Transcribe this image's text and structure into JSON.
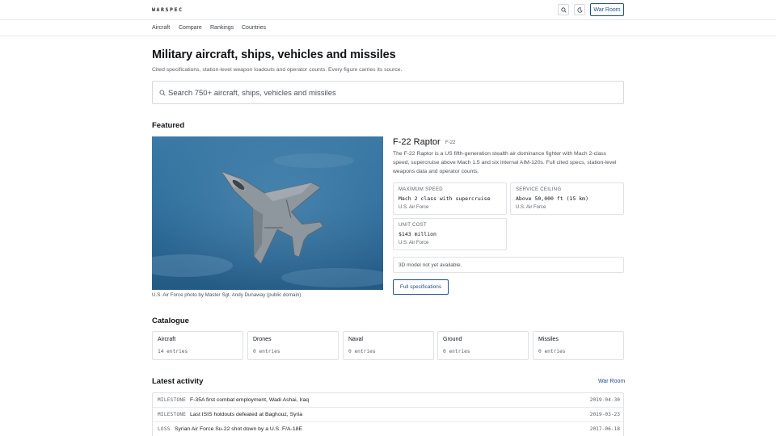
{
  "brand": {
    "logo": "WARSPEC"
  },
  "header": {
    "war_room_label": "War Room"
  },
  "nav": {
    "items": [
      "Aircraft",
      "Compare",
      "Rankings",
      "Countries"
    ]
  },
  "hero": {
    "title": "Military aircraft, ships, vehicles and missiles",
    "subtitle": "Cited specifications, station-level weapon loadouts and operator counts. Every figure carries its source."
  },
  "search": {
    "placeholder": "Search 750+ aircraft, ships, vehicles and missiles"
  },
  "featured": {
    "section_title": "Featured",
    "name": "F-22 Raptor",
    "code": "F-22",
    "description": "The F-22 Raptor is a US fifth-generation stealth air dominance fighter with Mach 2-class speed, supercruise above Mach 1.5 and six internal AIM-120s. Full cited specs, station-level weapons data and operator counts.",
    "image_credit": "U.S. Air Force photo by Master Sgt. Andy Dunaway (public domain)",
    "specs": [
      {
        "label": "MAXIMUM SPEED",
        "value": "Mach 2 class with supercruise",
        "source": "U.S. Air Force"
      },
      {
        "label": "SERVICE CEILING",
        "value": "Above 50,000 ft (15 km)",
        "source": "U.S. Air Force"
      },
      {
        "label": "UNIT COST",
        "value": "$143 million",
        "source": "U.S. Air Force"
      }
    ],
    "model_notice": "3D model not yet available.",
    "full_specs_label": "Full specifications"
  },
  "catalogue": {
    "section_title": "Catalogue",
    "categories": [
      {
        "name": "Aircraft",
        "count": "14 entries"
      },
      {
        "name": "Drones",
        "count": "0 entries"
      },
      {
        "name": "Naval",
        "count": "0 entries"
      },
      {
        "name": "Ground",
        "count": "0 entries"
      },
      {
        "name": "Missiles",
        "count": "0 entries"
      }
    ]
  },
  "activity": {
    "section_title": "Latest activity",
    "link_label": "War Room",
    "items": [
      {
        "type": "MILESTONE",
        "text": "F-35A first combat employment, Wadi Ashai, Iraq",
        "date": "2019-04-30"
      },
      {
        "type": "MILESTONE",
        "text": "Last ISIS holdouts defeated at Baghouz, Syria",
        "date": "2019-03-23"
      },
      {
        "type": "LOSS",
        "text": "Syrian Air Force Su-22 shot down by a U.S. F/A-18E",
        "date": "2017-06-18"
      }
    ]
  },
  "colors": {
    "accent": "#1f4e8c",
    "border": "#dfe2e6",
    "sky": "#2f6e9c"
  }
}
